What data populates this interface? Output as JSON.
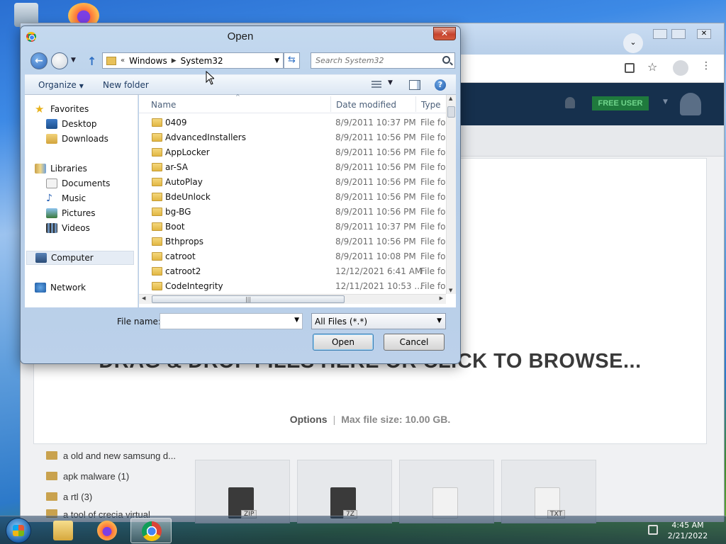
{
  "browser": {
    "header_badge": "FREE USER",
    "drop_text": "DRAG & DROP FILES HERE OR CLICK TO BROWSE...",
    "options_label": "Options",
    "max_size_label": "Max file size: 10.00 GB.",
    "side_folders": [
      "a old and new samsung d...",
      "apk malware (1)",
      "a rtl (3)",
      "a tool of crecia virtual"
    ],
    "tile_labels": [
      "ZIP",
      "7Z",
      "",
      "TXT"
    ]
  },
  "dialog": {
    "title": "Open",
    "close_label": "✕",
    "address": {
      "segment_1": "Windows",
      "segment_2": "System32"
    },
    "search_placeholder": "Search System32",
    "toolbar": {
      "organize": "Organize",
      "new_folder": "New folder"
    },
    "nav": {
      "favorites": "Favorites",
      "desktop": "Desktop",
      "downloads": "Downloads",
      "libraries": "Libraries",
      "documents": "Documents",
      "music": "Music",
      "pictures": "Pictures",
      "videos": "Videos",
      "computer": "Computer",
      "network": "Network"
    },
    "columns": {
      "name": "Name",
      "date": "Date modified",
      "type": "Type"
    },
    "files": [
      {
        "name": "0409",
        "date": "8/9/2011 10:37 PM",
        "type": "File fol"
      },
      {
        "name": "AdvancedInstallers",
        "date": "8/9/2011 10:56 PM",
        "type": "File fol"
      },
      {
        "name": "AppLocker",
        "date": "8/9/2011 10:56 PM",
        "type": "File fol"
      },
      {
        "name": "ar-SA",
        "date": "8/9/2011 10:56 PM",
        "type": "File fol"
      },
      {
        "name": "AutoPlay",
        "date": "8/9/2011 10:56 PM",
        "type": "File fol"
      },
      {
        "name": "BdeUnlock",
        "date": "8/9/2011 10:56 PM",
        "type": "File fol"
      },
      {
        "name": "bg-BG",
        "date": "8/9/2011 10:56 PM",
        "type": "File fol"
      },
      {
        "name": "Boot",
        "date": "8/9/2011 10:37 PM",
        "type": "File fol"
      },
      {
        "name": "Bthprops",
        "date": "8/9/2011 10:56 PM",
        "type": "File fol"
      },
      {
        "name": "catroot",
        "date": "8/9/2011 10:08 PM",
        "type": "File fol"
      },
      {
        "name": "catroot2",
        "date": "12/12/2021 6:41 AM",
        "type": "File fol"
      },
      {
        "name": "CodeIntegrity",
        "date": "12/11/2021 10:53 ...",
        "type": "File fol"
      }
    ],
    "file_name_label": "File name:",
    "file_name_value": "",
    "file_type": "All Files (*.*)",
    "open_label": "Open",
    "cancel_label": "Cancel"
  },
  "taskbar": {
    "time": "4:45 AM",
    "date": "2/21/2022"
  }
}
